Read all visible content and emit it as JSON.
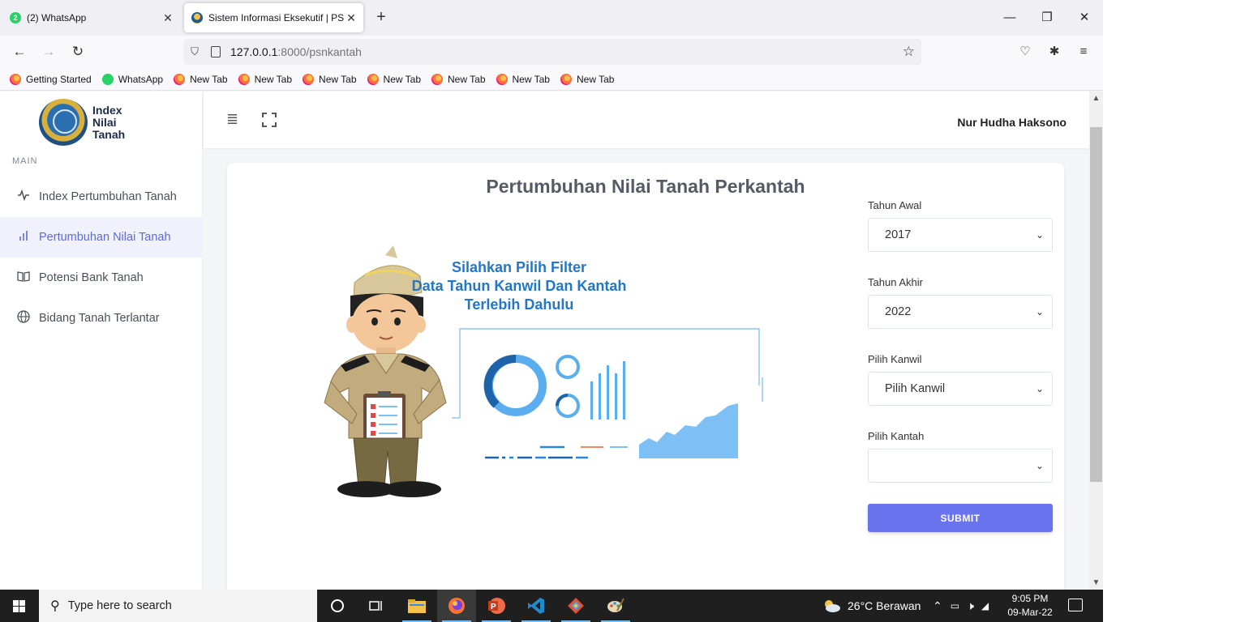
{
  "browser": {
    "tabs": [
      {
        "label": "(2) WhatsApp",
        "badge": "2",
        "active": false
      },
      {
        "label": "Sistem Informasi Eksekutif | PSN",
        "active": true
      }
    ],
    "url": {
      "host": "127.0.0.1",
      "path": ":8000/psnkantah"
    },
    "bookmarks": [
      "Getting Started",
      "WhatsApp",
      "New Tab",
      "New Tab",
      "New Tab",
      "New Tab",
      "New Tab",
      "New Tab",
      "New Tab"
    ]
  },
  "sidebar": {
    "logo_lines": [
      "Index",
      "Nilai",
      "Tanah"
    ],
    "section_label": "MAIN",
    "items": [
      {
        "label": "Index Pertumbuhan Tanah",
        "icon": "activity-icon"
      },
      {
        "label": "Pertumbuhan Nilai Tanah",
        "icon": "bar-chart-icon",
        "active": true
      },
      {
        "label": "Potensi Bank Tanah",
        "icon": "book-icon"
      },
      {
        "label": "Bidang Tanah Terlantar",
        "icon": "globe-icon"
      }
    ]
  },
  "topbar": {
    "user_name": "Nur Hudha Haksono"
  },
  "card": {
    "title": "Pertumbuhan Nilai Tanah Perkantah",
    "illustration_text": [
      "Silahkan Pilih Filter",
      "Data Tahun Kanwil Dan Kantah",
      "Terlebih Dahulu"
    ]
  },
  "form": {
    "tahun_awal": {
      "label": "Tahun Awal",
      "value": "2017"
    },
    "tahun_akhir": {
      "label": "Tahun Akhir",
      "value": "2022"
    },
    "kanwil": {
      "label": "Pilih Kanwil",
      "value": "Pilih Kanwil"
    },
    "kantah": {
      "label": "Pilih Kantah",
      "value": ""
    },
    "submit_label": "SUBMIT"
  },
  "taskbar": {
    "search_placeholder": "Type here to search",
    "weather": "26°C  Berawan",
    "time": "9:05 PM",
    "date": "09-Mar-22"
  },
  "colors": {
    "accent": "#6a74ee",
    "sidebar_active": "#5c6bd8",
    "illustration_blue": "#2277c8"
  }
}
